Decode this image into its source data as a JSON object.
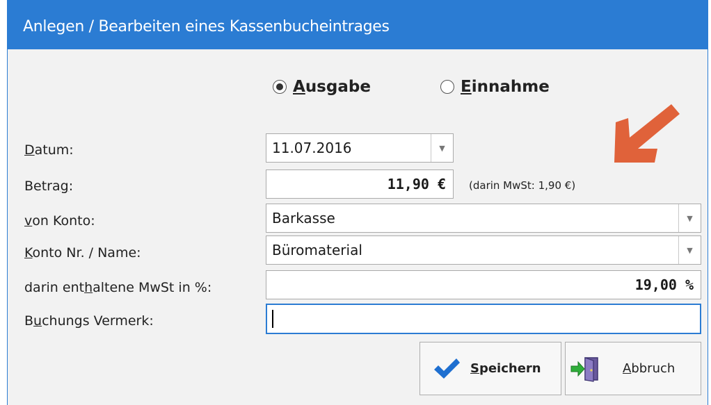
{
  "window": {
    "title": "Anlegen / Bearbeiten eines Kassenbucheintrages"
  },
  "type_choice": {
    "ausgabe": {
      "accel": "A",
      "rest": "usgabe",
      "selected": true
    },
    "einnahme": {
      "accel": "E",
      "rest": "innahme",
      "selected": false
    }
  },
  "form": {
    "datum": {
      "label_accel": "D",
      "label_rest": "atum:",
      "value": "11.07.2016"
    },
    "betrag": {
      "label_pre": "Betra",
      "label_accel": "g",
      "label_post": ":",
      "value": "11,90 €",
      "hint": "(darin MwSt: 1,90 €)"
    },
    "von_konto": {
      "label_accel": "v",
      "label_rest": "on Konto:",
      "value": "Barkasse"
    },
    "konto_nr": {
      "label_accel": "K",
      "label_rest": "onto Nr. / Name:",
      "value": "Büromaterial"
    },
    "mwst": {
      "label_pre": "darin ent",
      "label_accel": "h",
      "label_post": "altene MwSt in %:",
      "value": "19,00 %"
    },
    "vermerk": {
      "label_pre": "B",
      "label_accel": "u",
      "label_post": "chungs Vermerk:",
      "value": ""
    }
  },
  "buttons": {
    "save": {
      "accel": "S",
      "rest": "peichern"
    },
    "cancel": {
      "accel": "A",
      "rest": "bbruch"
    }
  },
  "colors": {
    "titlebar": "#2b7cd3",
    "arrow": "#e0623a",
    "checkmark": "#1e6fd0"
  }
}
